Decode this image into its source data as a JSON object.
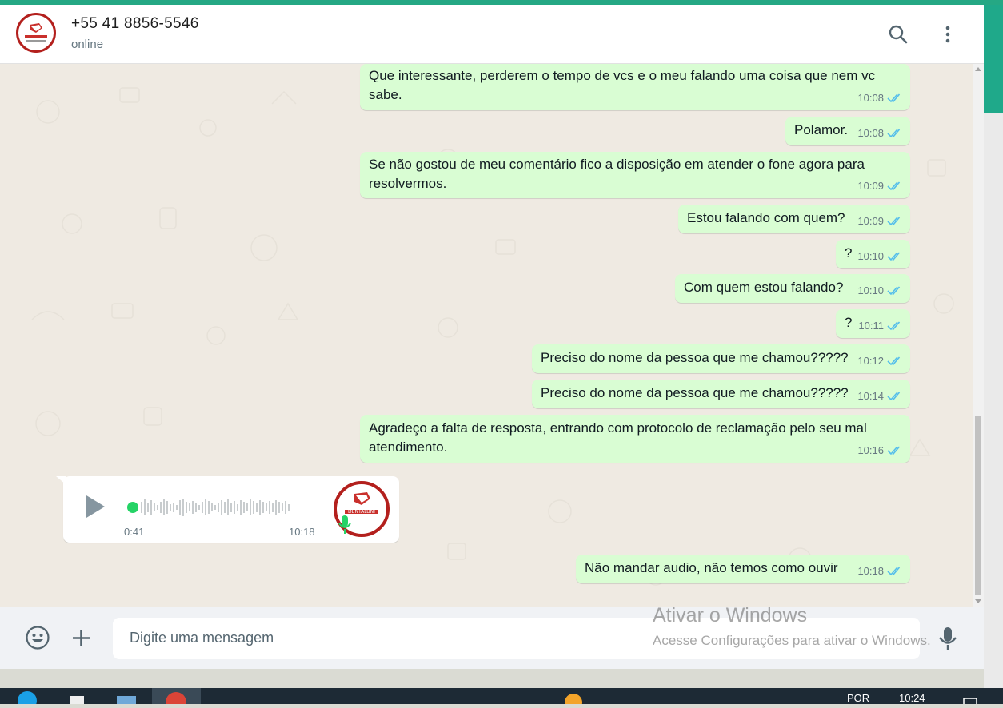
{
  "header": {
    "contact_name": "+55 41 8856-5546",
    "status": "online"
  },
  "messages": [
    {
      "text_line1": "Que interessante, perderem o tempo de vcs e o meu falando uma coisa que nem vc",
      "text_line2": "sabe.",
      "time": "10:08"
    },
    {
      "text": "Polamor.",
      "time": "10:08"
    },
    {
      "text_line1": "Se não gostou de meu comentário fico a disposição em atender o fone agora para",
      "text_line2": "resolvermos.",
      "time": "10:09"
    },
    {
      "text": "Estou falando com quem?",
      "time": "10:09"
    },
    {
      "text": "?",
      "time": "10:10"
    },
    {
      "text": "Com quem estou falando?",
      "time": "10:10"
    },
    {
      "text": "?",
      "time": "10:11"
    },
    {
      "text": "Preciso do nome da pessoa que me chamou?????",
      "time": "10:12"
    },
    {
      "text": "Preciso do nome da pessoa que me chamou?????",
      "time": "10:14"
    },
    {
      "text_line1": "Agradeço a falta de resposta, entrando com protocolo de reclamação pelo seu mal",
      "text_line2": "atendimento.",
      "time": "10:16"
    },
    {
      "text": "Não mandar audio, não temos como ouvir",
      "time": "10:18"
    }
  ],
  "audio_message": {
    "duration": "0:41",
    "time": "10:18"
  },
  "avatar_brand": "DENTALUNI",
  "composer": {
    "placeholder": "Digite uma mensagem"
  },
  "watermark": {
    "title": "Ativar o Windows",
    "subtitle": "Acesse Configurações para ativar o Windows."
  },
  "taskbar": {
    "language": "POR",
    "clock": "10:24"
  },
  "colors": {
    "outgoing_bubble": "#d9fdd3",
    "read_tick": "#53bdeb",
    "accent": "#25a884",
    "brand_red": "#b3201d"
  }
}
